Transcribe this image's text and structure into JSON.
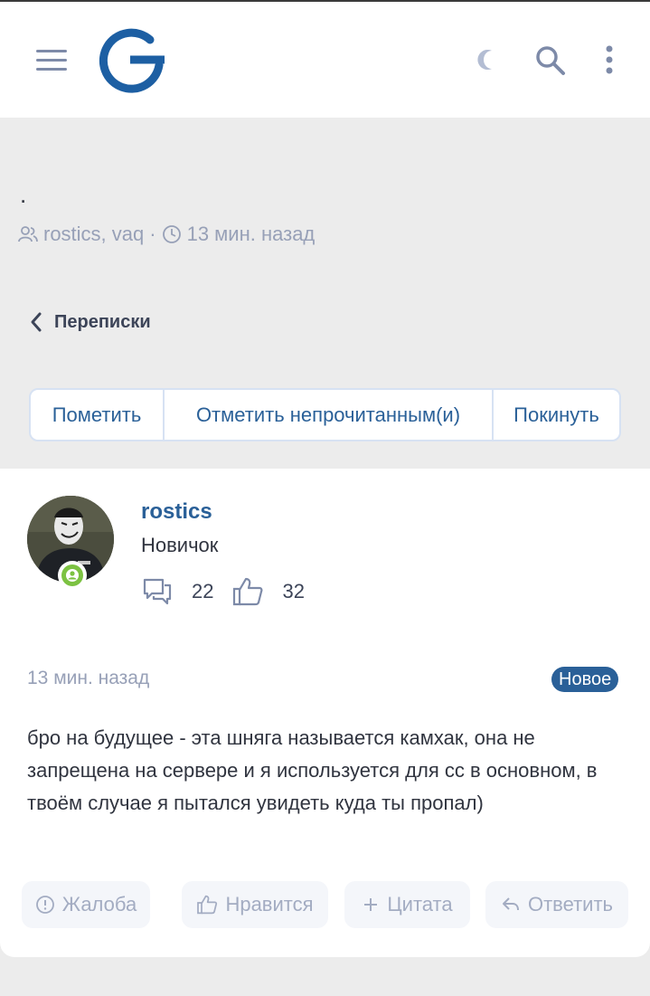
{
  "header": {
    "menu_icon": "hamburger-menu-icon",
    "logo": "site-logo",
    "theme_icon": "moon-icon",
    "search_icon": "search-icon",
    "more_icon": "kebab-more-icon"
  },
  "thread": {
    "title": ".",
    "participants": "rostics, vaq",
    "separator": "·",
    "time": "13 мин. назад",
    "breadcrumb": "Переписки",
    "actions": [
      "Пометить",
      "Отметить непрочитанным(и)",
      "Покинуть"
    ]
  },
  "post": {
    "username": "rostics",
    "user_title": "Новичок",
    "messages_count": "22",
    "reactions_count": "32",
    "time": "13 мин. назад",
    "badge": "Новое",
    "body": "бро на будущее - эта шняга называется камхак, она не запрещена на сервере и я используется для сс в основном, в твоём случае я пытался увидеть куда ты пропал)",
    "actions": {
      "report": "Жалоба",
      "like": "Нравится",
      "quote": "Цитата",
      "reply": "Ответить"
    }
  },
  "colors": {
    "accent": "#2a6098",
    "muted": "#97a0b7",
    "online": "#7cc242",
    "background": "#ececec"
  }
}
